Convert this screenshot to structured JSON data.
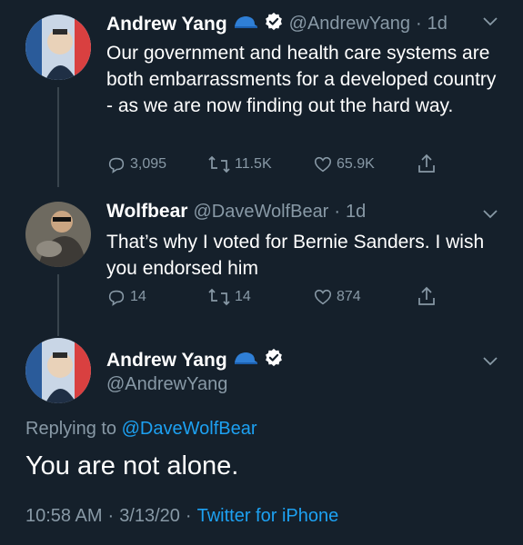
{
  "tweets": [
    {
      "name": "Andrew Yang",
      "handle": "@AndrewYang",
      "time": "1d",
      "text": "Our government and health care systems are both embarrassments for a developed country - as we are now finding out the hard way.",
      "replies": "3,095",
      "retweets": "11.5K",
      "likes": "65.9K"
    },
    {
      "name": "Wolfbear",
      "handle": "@DaveWolfBear",
      "time": "1d",
      "text": "That’s why I voted for Bernie Sanders.  I wish you endorsed him",
      "replies": "14",
      "retweets": "14",
      "likes": "874"
    }
  ],
  "main_tweet": {
    "name": "Andrew Yang",
    "handle": "@AndrewYang",
    "replying_prefix": "Replying to",
    "replying_to": "@DaveWolfBear",
    "text": "You are not alone.",
    "time": "10:58 AM",
    "date": "3/13/20",
    "source": "Twitter for iPhone"
  },
  "separator": "·",
  "colors": {
    "background": "#15202b",
    "secondary_text": "#8899a6",
    "link": "#1da1f2",
    "verified": "#ffffff"
  },
  "icons": [
    "reply-icon",
    "retweet-icon",
    "like-icon",
    "share-icon",
    "verified-icon",
    "cap-emoji-icon",
    "chevron-down-icon"
  ]
}
